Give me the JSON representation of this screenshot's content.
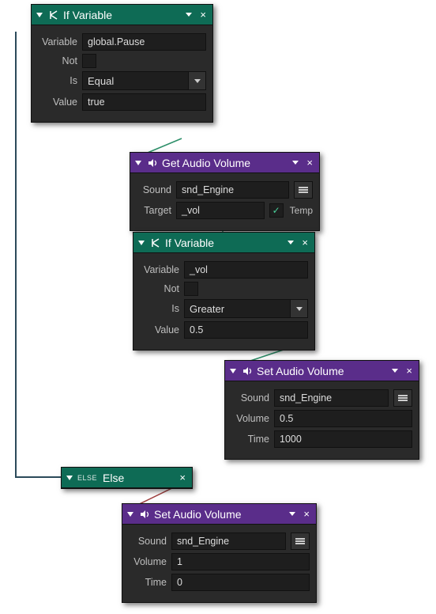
{
  "node1": {
    "title": "If Variable",
    "labels": {
      "variable": "Variable",
      "not": "Not",
      "is": "Is",
      "value": "Value"
    },
    "variable": "global.Pause",
    "is": "Equal",
    "value": "true"
  },
  "node2": {
    "title": "Get Audio Volume",
    "labels": {
      "sound": "Sound",
      "target": "Target",
      "temp": "Temp"
    },
    "sound": "snd_Engine",
    "target": "_vol",
    "temp_checked": true
  },
  "node3": {
    "title": "If Variable",
    "labels": {
      "variable": "Variable",
      "not": "Not",
      "is": "Is",
      "value": "Value"
    },
    "variable": "_vol",
    "is": "Greater",
    "value": "0.5"
  },
  "node4": {
    "title": "Set Audio Volume",
    "labels": {
      "sound": "Sound",
      "volume": "Volume",
      "time": "Time"
    },
    "sound": "snd_Engine",
    "volume": "0.5",
    "time": "1000"
  },
  "node5": {
    "tag": "ELSE",
    "title": "Else"
  },
  "node6": {
    "title": "Set Audio Volume",
    "labels": {
      "sound": "Sound",
      "volume": "Volume",
      "time": "Time"
    },
    "sound": "snd_Engine",
    "volume": "1",
    "time": "0"
  }
}
